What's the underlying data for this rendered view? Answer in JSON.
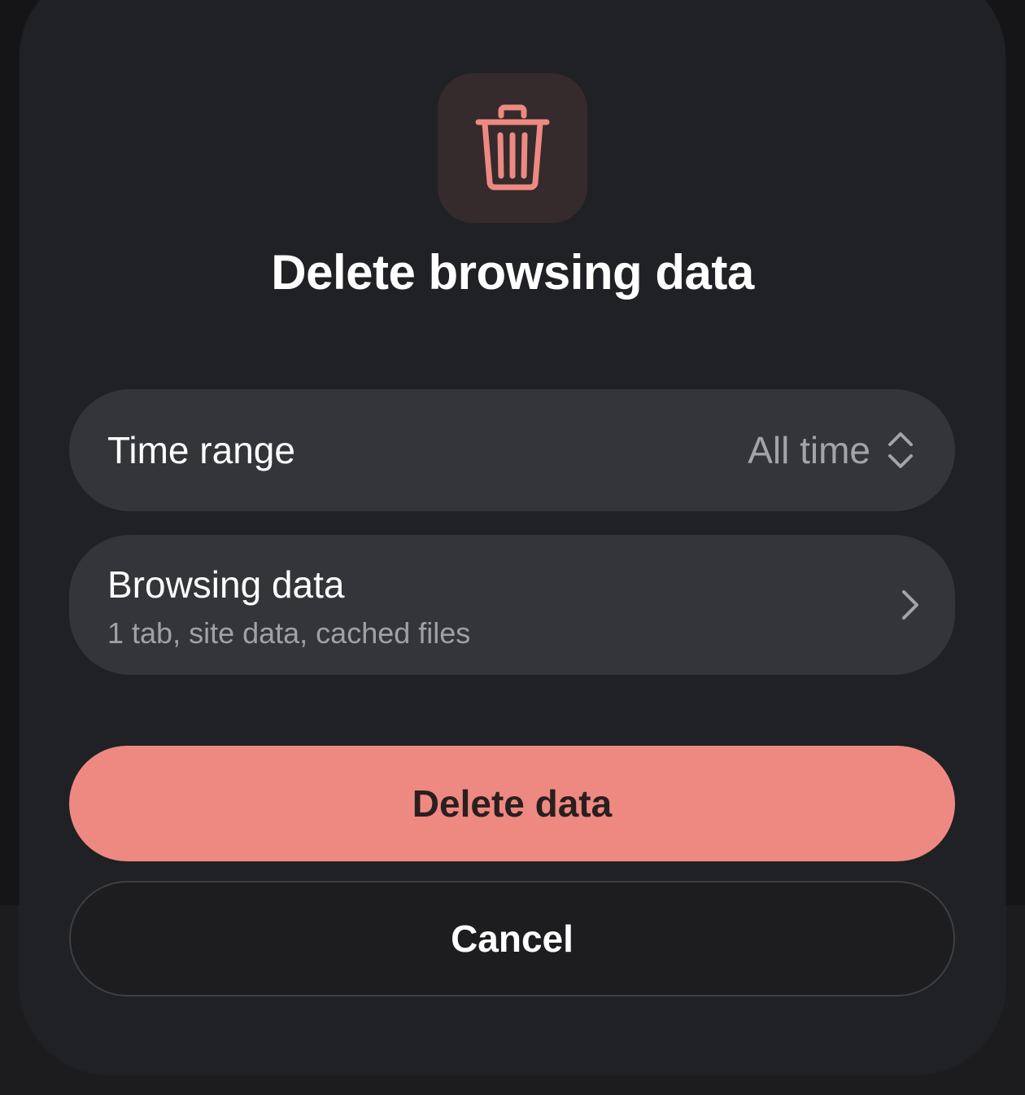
{
  "dialog": {
    "icon": "trash-icon",
    "accent_color": "#ee8982",
    "title": "Delete browsing data",
    "time_range": {
      "label": "Time range",
      "value": "All time",
      "icon": "chevron-up-down-icon"
    },
    "browsing_data": {
      "label": "Browsing data",
      "summary": "1 tab, site data, cached files",
      "icon": "chevron-right-icon"
    },
    "delete_button": "Delete data",
    "cancel_button": "Cancel"
  }
}
